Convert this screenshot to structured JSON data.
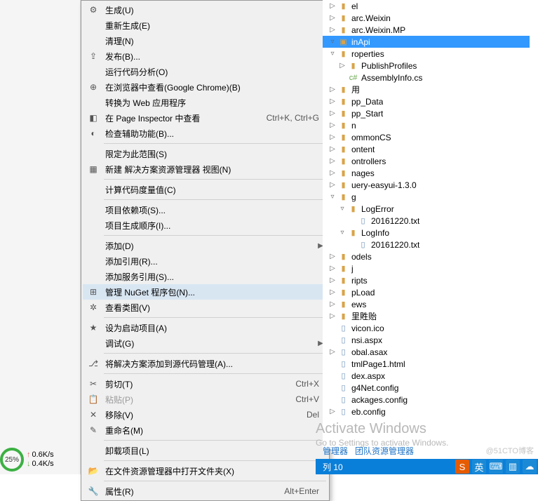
{
  "menu": {
    "items": [
      {
        "label": "生成(U)",
        "icon": "build-icon"
      },
      {
        "label": "重新生成(E)"
      },
      {
        "label": "清理(N)"
      },
      {
        "label": "发布(B)...",
        "icon": "publish-icon"
      },
      {
        "label": "运行代码分析(O)"
      },
      {
        "label": "在浏览器中查看(Google Chrome)(B)",
        "icon": "browser-icon"
      },
      {
        "label": "转换为 Web 应用程序"
      },
      {
        "label": "在 Page Inspector 中查看",
        "icon": "inspector-icon",
        "shortcut": "Ctrl+K, Ctrl+G"
      },
      {
        "label": "检查辅助功能(B)...",
        "icon": "accessibility-icon"
      },
      {
        "sep": true
      },
      {
        "label": "限定为此范围(S)"
      },
      {
        "label": "新建 解决方案资源管理器 视图(N)",
        "icon": "new-view-icon"
      },
      {
        "sep": true
      },
      {
        "label": "计算代码度量值(C)"
      },
      {
        "sep": true
      },
      {
        "label": "项目依赖项(S)..."
      },
      {
        "label": "项目生成顺序(I)..."
      },
      {
        "sep": true
      },
      {
        "label": "添加(D)",
        "submenu": true
      },
      {
        "label": "添加引用(R)..."
      },
      {
        "label": "添加服务引用(S)..."
      },
      {
        "label": "管理 NuGet 程序包(N)...",
        "icon": "nuget-icon",
        "hovered": true
      },
      {
        "label": "查看类图(V)",
        "icon": "classdiagram-icon"
      },
      {
        "sep": true
      },
      {
        "label": "设为启动项目(A)",
        "icon": "startup-icon"
      },
      {
        "label": "调试(G)",
        "submenu": true
      },
      {
        "sep": true
      },
      {
        "label": "将解决方案添加到源代码管理(A)...",
        "icon": "source-control-icon"
      },
      {
        "sep": true
      },
      {
        "label": "剪切(T)",
        "icon": "cut-icon",
        "shortcut": "Ctrl+X"
      },
      {
        "label": "粘贴(P)",
        "icon": "paste-icon",
        "shortcut": "Ctrl+V",
        "disabled": true
      },
      {
        "label": "移除(V)",
        "icon": "remove-icon",
        "shortcut": "Del"
      },
      {
        "label": "重命名(M)",
        "icon": "rename-icon"
      },
      {
        "sep": true
      },
      {
        "label": "卸载项目(L)"
      },
      {
        "sep": true
      },
      {
        "label": "在文件资源管理器中打开文件夹(X)",
        "icon": "open-folder-icon"
      },
      {
        "sep": true
      },
      {
        "label": "属性(R)",
        "icon": "properties-icon",
        "shortcut": "Alt+Enter"
      }
    ]
  },
  "tree": {
    "items": [
      {
        "label": "el",
        "glyph": "▷",
        "type": "folder"
      },
      {
        "label": "arc.Weixin",
        "glyph": "▷",
        "type": "folder"
      },
      {
        "label": "arc.Weixin.MP",
        "glyph": "▷",
        "type": "folder"
      },
      {
        "label": "inApi",
        "glyph": "▿",
        "type": "project",
        "selected": true
      },
      {
        "label": "roperties",
        "glyph": "▿",
        "type": "folder"
      },
      {
        "label": "PublishProfiles",
        "glyph": "▷",
        "type": "folder",
        "indent": 1
      },
      {
        "label": "AssemblyInfo.cs",
        "type": "cs",
        "indent": 1
      },
      {
        "label": "用",
        "glyph": "▷",
        "type": "folder"
      },
      {
        "label": "pp_Data",
        "glyph": "▷",
        "type": "folder"
      },
      {
        "label": "pp_Start",
        "glyph": "▷",
        "type": "folder"
      },
      {
        "label": "n",
        "glyph": "▷",
        "type": "folder"
      },
      {
        "label": "ommonCS",
        "glyph": "▷",
        "type": "folder"
      },
      {
        "label": "ontent",
        "glyph": "▷",
        "type": "folder"
      },
      {
        "label": "ontrollers",
        "glyph": "▷",
        "type": "folder"
      },
      {
        "label": "nages",
        "glyph": "▷",
        "type": "folder"
      },
      {
        "label": "uery-easyui-1.3.0",
        "glyph": "▷",
        "type": "folder"
      },
      {
        "label": "g",
        "glyph": "▿",
        "type": "folder"
      },
      {
        "label": "LogError",
        "glyph": "▿",
        "type": "folder",
        "indent": 1
      },
      {
        "label": "20161220.txt",
        "type": "file",
        "indent": 2
      },
      {
        "label": "LogInfo",
        "glyph": "▿",
        "type": "folder",
        "indent": 1
      },
      {
        "label": "20161220.txt",
        "type": "file",
        "indent": 2
      },
      {
        "label": "odels",
        "glyph": "▷",
        "type": "folder"
      },
      {
        "label": "j",
        "glyph": "▷",
        "type": "folder"
      },
      {
        "label": "ripts",
        "glyph": "▷",
        "type": "folder"
      },
      {
        "label": "pLoad",
        "glyph": "▷",
        "type": "folder"
      },
      {
        "label": "ews",
        "glyph": "▷",
        "type": "folder"
      },
      {
        "label": "里貹贻",
        "glyph": "▷",
        "type": "folder"
      },
      {
        "label": "vicon.ico",
        "type": "file"
      },
      {
        "label": "nsi.aspx",
        "type": "file"
      },
      {
        "label": "obal.asax",
        "glyph": "▷",
        "type": "file"
      },
      {
        "label": "tmlPage1.html",
        "type": "file"
      },
      {
        "label": "dex.aspx",
        "type": "file"
      },
      {
        "label": "g4Net.config",
        "type": "file"
      },
      {
        "label": "ackages.config",
        "type": "file"
      },
      {
        "label": "eb.config",
        "glyph": "▷",
        "type": "file"
      }
    ]
  },
  "watermark": {
    "title": "Activate Windows",
    "subtitle": "Go to Settings to activate Windows."
  },
  "blog_watermark": "@51CTO博客",
  "bottom_tabs": [
    "管理器",
    "团队资源管理器"
  ],
  "status": {
    "col_label": "列 10"
  },
  "net": {
    "pct": "25%",
    "up": "0.6K/s",
    "down": "0.4K/s"
  },
  "taskbar": {
    "ime_lang": "英",
    "icons": [
      "S",
      "英",
      "⌨",
      "▥",
      "☁"
    ]
  }
}
